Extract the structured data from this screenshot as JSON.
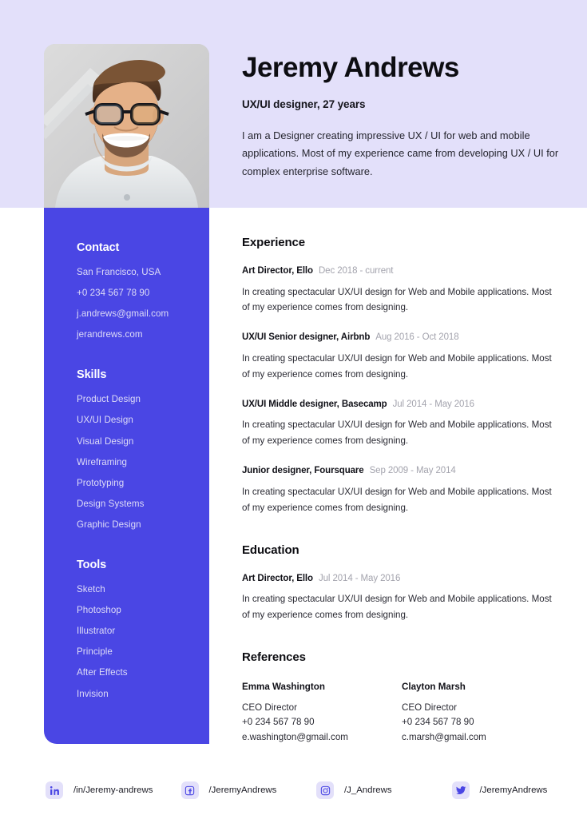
{
  "header": {
    "name": "Jeremy Andrews",
    "role": "UX/UI designer, 27 years",
    "summary": "I am a Designer creating impressive UX / UI for web and mobile applications. Most of my experience came from developing UX / UI for complex enterprise software.",
    "photo_alt": "portrait-photo"
  },
  "sidebar": {
    "contact": {
      "title": "Contact",
      "items": [
        "San Francisco, USA",
        "+0 234 567 78 90",
        "j.andrews@gmail.com",
        "jerandrews.com"
      ]
    },
    "skills": {
      "title": "Skills",
      "items": [
        "Product Design",
        "UX/UI Design",
        "Visual Design",
        "Wireframing",
        "Prototyping",
        "Design Systems",
        "Graphic Design"
      ]
    },
    "tools": {
      "title": "Tools",
      "items": [
        "Sketch",
        "Photoshop",
        "Illustrator",
        "Principle",
        "After Effects",
        "Invision"
      ]
    }
  },
  "main": {
    "experience": {
      "title": "Experience",
      "entries": [
        {
          "role": "Art Director, Ello",
          "date": "Dec 2018 - current",
          "desc": "In creating spectacular UX/UI design for Web and Mobile applications. Most of my experience comes from designing."
        },
        {
          "role": "UX/UI Senior designer, Airbnb",
          "date": "Aug 2016 - Oct 2018",
          "desc": "In creating spectacular UX/UI design for Web and Mobile applications. Most of my experience comes from designing."
        },
        {
          "role": "UX/UI Middle designer, Basecamp",
          "date": "Jul 2014 - May 2016",
          "desc": "In creating spectacular UX/UI design for Web and Mobile applications. Most of my experience comes from designing."
        },
        {
          "role": "Junior designer, Foursquare",
          "date": "Sep 2009 - May 2014",
          "desc": "In creating spectacular UX/UI design for Web and Mobile applications. Most of my experience comes from designing."
        }
      ]
    },
    "education": {
      "title": "Education",
      "entries": [
        {
          "role": "Art Director, Ello",
          "date": "Jul 2014 - May 2016",
          "desc": "In creating spectacular UX/UI design for Web and Mobile applications. Most of my experience comes from designing."
        }
      ]
    },
    "references": {
      "title": "References",
      "people": [
        {
          "name": "Emma Washington",
          "position": "CEO Director",
          "phone": "+0 234 567 78 90",
          "email": "e.washington@gmail.com"
        },
        {
          "name": "Clayton Marsh",
          "position": "CEO Director",
          "phone": "+0 234 567 78 90",
          "email": "c.marsh@gmail.com"
        }
      ]
    }
  },
  "footer": {
    "socials": [
      {
        "icon": "linkedin-icon",
        "label": "/in/Jeremy-andrews"
      },
      {
        "icon": "facebook-icon",
        "label": "/JeremyAndrews"
      },
      {
        "icon": "instagram-icon",
        "label": "/J_Andrews"
      },
      {
        "icon": "twitter-icon",
        "label": "/JeremyAndrews"
      }
    ]
  },
  "colors": {
    "accent_blue": "#4a46e4",
    "lavender": "#e3e0fa",
    "ink": "#0d0d12",
    "muted_date": "#a3a3ad",
    "sidebar_text": "#dedcf7"
  }
}
